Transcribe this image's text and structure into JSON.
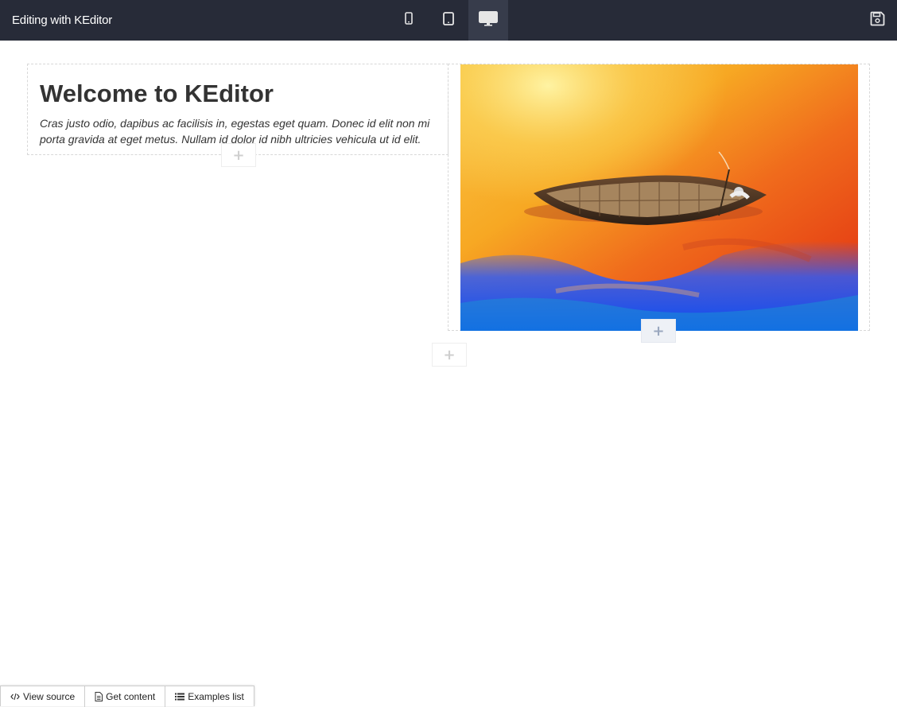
{
  "header": {
    "title": "Editing with KEditor",
    "devices": [
      {
        "name": "mobile",
        "icon": "mobile-icon",
        "active": false
      },
      {
        "name": "tablet",
        "icon": "tablet-icon",
        "active": false
      },
      {
        "name": "desktop",
        "icon": "desktop-icon",
        "active": true
      }
    ],
    "save_icon": "floppy-disk-icon"
  },
  "content": {
    "heading": "Welcome to KEditor",
    "paragraph": "Cras justo odio, dapibus ac facilisis in, egestas eget quam. Donec id elit non mi porta gravida at eget metus. Nullam id dolor id nibh ultricies vehicula ut id elit.",
    "add_label": "+"
  },
  "footer": {
    "view_source": "View source",
    "get_content": "Get content",
    "examples_list": "Examples list"
  },
  "colors": {
    "topbar": "#272b38",
    "active_device": "#373c4b"
  }
}
